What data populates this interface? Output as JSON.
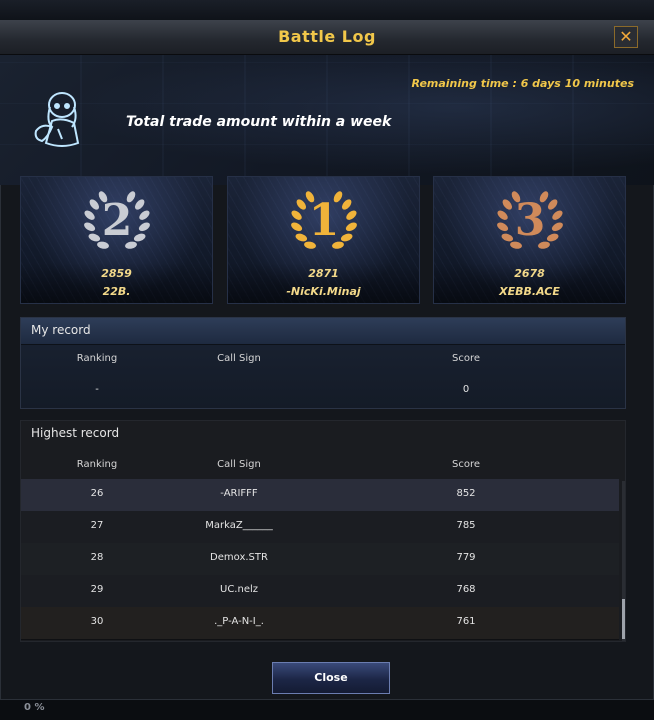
{
  "window": {
    "title": "Battle Log",
    "close_icon": "✕",
    "close_button_label": "Close"
  },
  "banner": {
    "remaining_time": "Remaining time : 6 days 10 minutes",
    "subtitle": "Total trade amount within a week",
    "mascot_icon": "chibi-character-icon"
  },
  "podium": [
    {
      "rank": "2",
      "score": "2859",
      "name": "22B.",
      "medal": "silver",
      "color": "#c9ccd3"
    },
    {
      "rank": "1",
      "score": "2871",
      "name": "-NicKi.Minaj",
      "medal": "gold",
      "color": "#f0b33a"
    },
    {
      "rank": "3",
      "score": "2678",
      "name": "XEBB.ACE",
      "medal": "bronze",
      "color": "#d08a5a"
    }
  ],
  "my_record": {
    "title": "My record",
    "headers": {
      "ranking": "Ranking",
      "call_sign": "Call Sign",
      "score": "Score"
    },
    "ranking": "-",
    "call_sign": "",
    "score": "0"
  },
  "highest_record": {
    "title": "Highest record",
    "headers": {
      "ranking": "Ranking",
      "call_sign": "Call Sign",
      "score": "Score"
    },
    "rows": [
      {
        "ranking": "26",
        "call_sign": "-ARIFFF",
        "score": "852"
      },
      {
        "ranking": "27",
        "call_sign": "MarkaZ______",
        "score": "785"
      },
      {
        "ranking": "28",
        "call_sign": "Demox.STR",
        "score": "779"
      },
      {
        "ranking": "29",
        "call_sign": "UC.nelz",
        "score": "768"
      },
      {
        "ranking": "30",
        "call_sign": "._P-A-N-I_.",
        "score": "761"
      }
    ]
  },
  "background": {
    "bottom_progress": "0 %"
  },
  "colors": {
    "accent_gold": "#f1c74a",
    "title_bar": "#2b2f36",
    "panel_blue": "#1e2a40"
  }
}
